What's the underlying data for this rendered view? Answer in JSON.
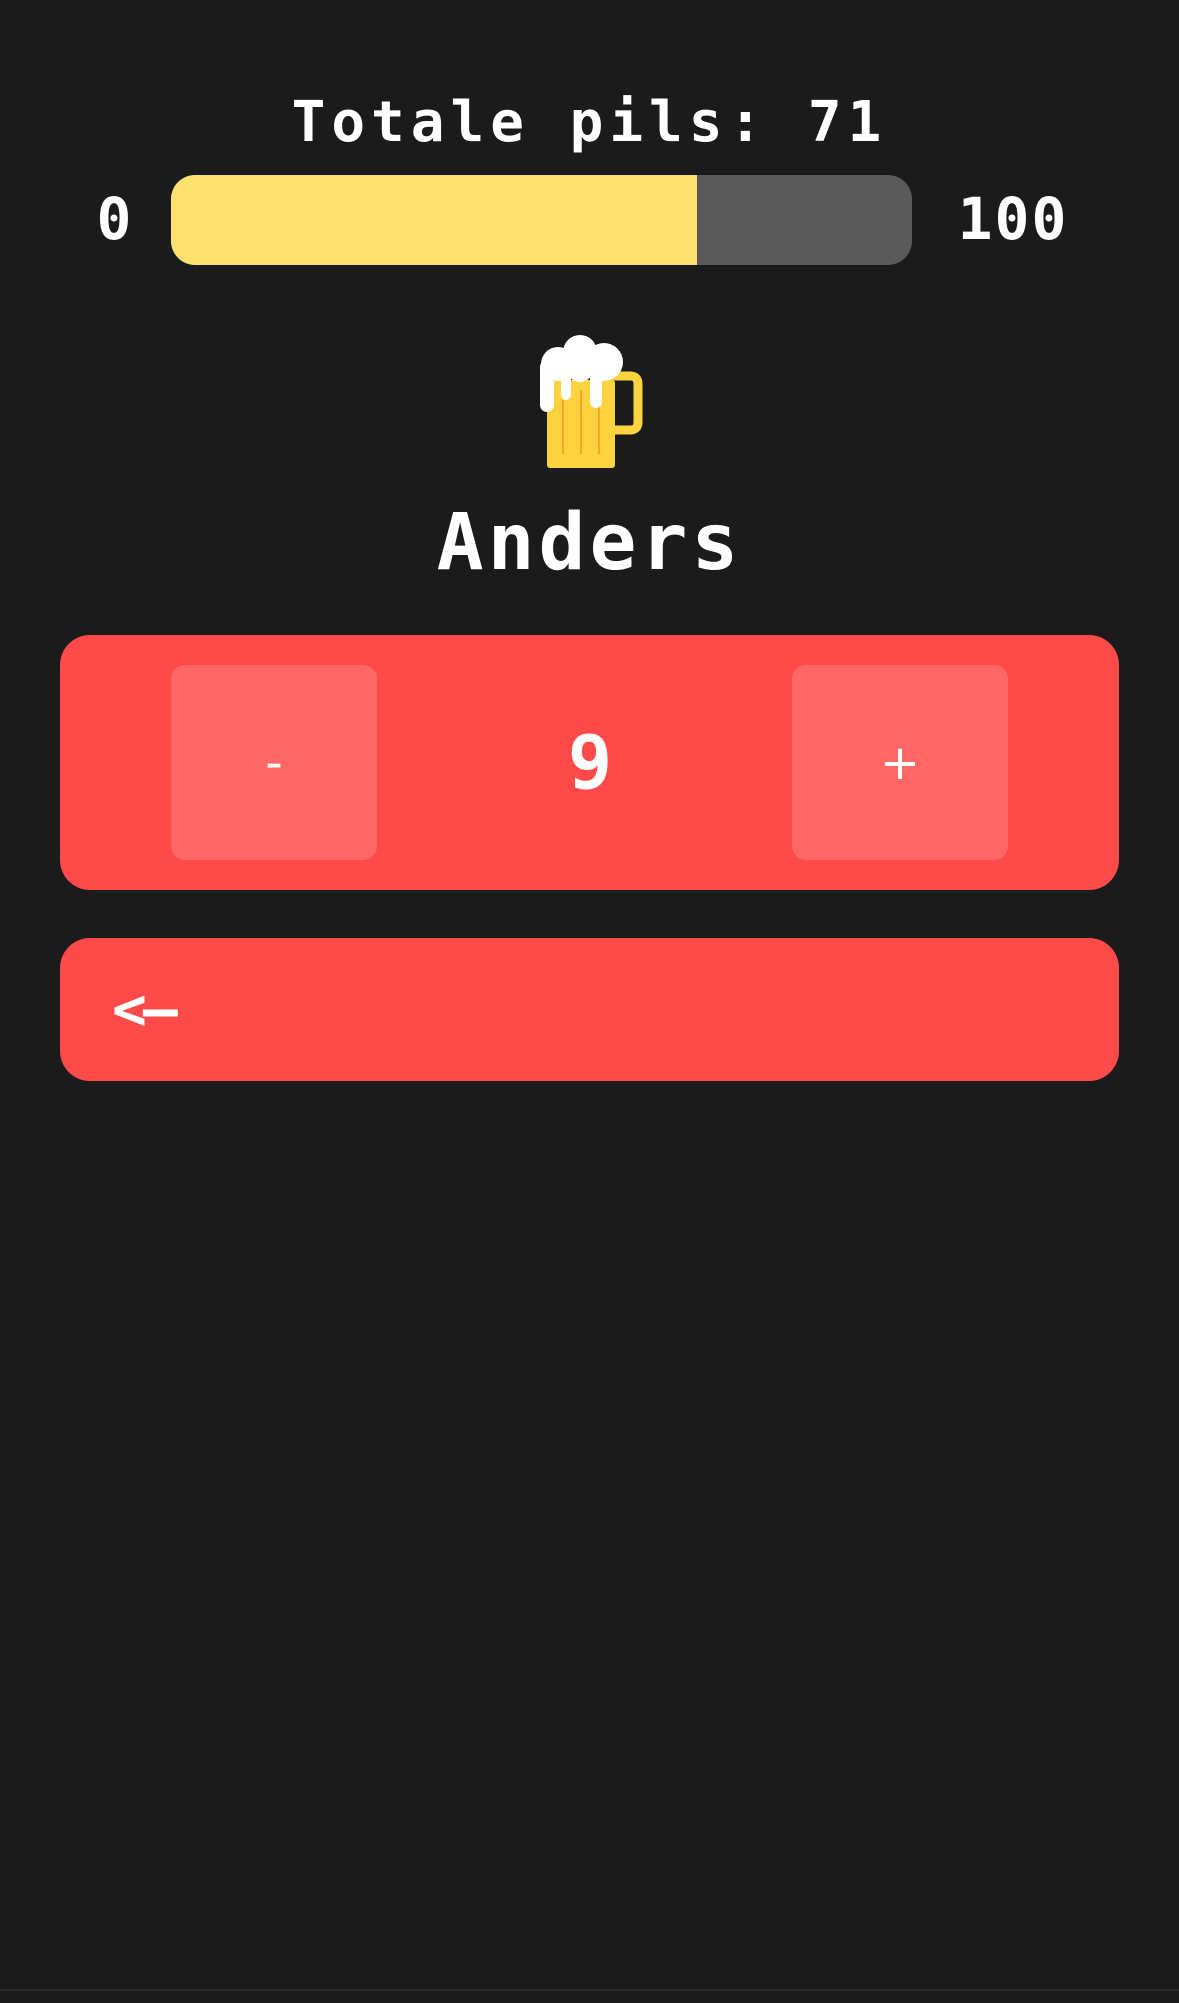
{
  "header": {
    "title": "Totale pils: 71"
  },
  "progress": {
    "min_label": "0",
    "max_label": "100",
    "value": 71,
    "max": 100,
    "fill_color": "#fde06f",
    "track_color": "#595959"
  },
  "player": {
    "icon": "beer-mug-icon",
    "name": "Anders"
  },
  "counter": {
    "minus_label": "-",
    "value": "9",
    "plus_label": "+"
  },
  "back": {
    "label": "<—"
  },
  "colors": {
    "background": "#1b1b1b",
    "card": "#ff4a4a",
    "button": "#ff6767"
  }
}
